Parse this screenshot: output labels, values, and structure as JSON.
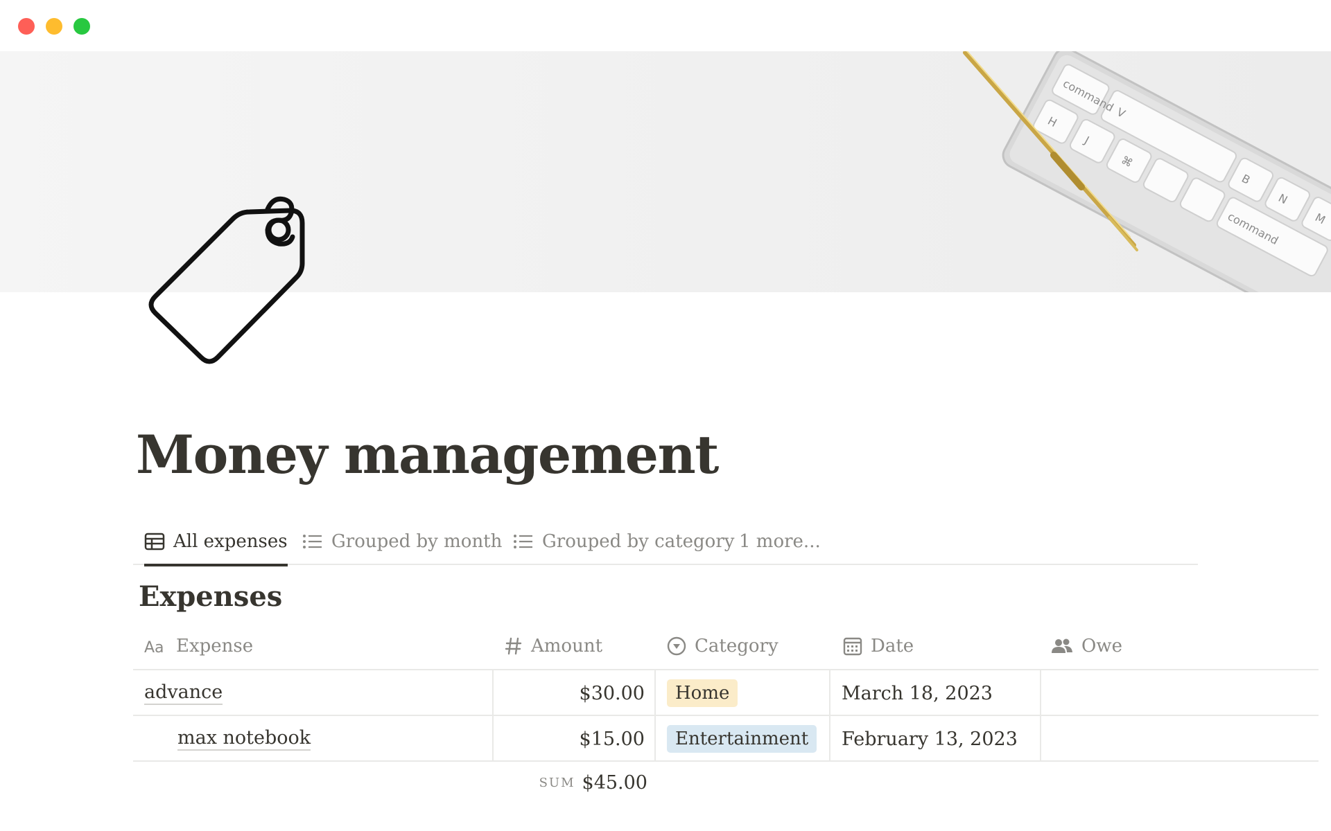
{
  "window": {
    "controls": [
      "close",
      "minimize",
      "maximize"
    ],
    "colors": {
      "close": "#fe5f57",
      "minimize": "#febc2e",
      "maximize": "#28c840"
    }
  },
  "cover": {
    "description_icon": "desk-cover-image",
    "keyboard_keys": [
      "command",
      "V",
      "B",
      "N",
      "M",
      "H",
      "J",
      "⌘",
      "command"
    ]
  },
  "page": {
    "icon": "price-tag-icon",
    "title": "Money management"
  },
  "views": {
    "tabs": [
      {
        "label": "All expenses",
        "icon": "table-icon",
        "active": true
      },
      {
        "label": "Grouped by month",
        "icon": "list-icon",
        "active": false
      },
      {
        "label": "Grouped by category",
        "icon": "list-icon",
        "active": false
      },
      {
        "label": "1 more...",
        "icon": "",
        "active": false
      }
    ]
  },
  "database": {
    "title": "Expenses",
    "columns": [
      {
        "label": "Expense",
        "icon": "text-property-icon"
      },
      {
        "label": "Amount",
        "icon": "number-property-icon"
      },
      {
        "label": "Category",
        "icon": "select-property-icon"
      },
      {
        "label": "Date",
        "icon": "calendar-icon"
      },
      {
        "label": "Owe",
        "icon": "people-icon"
      }
    ],
    "rows": [
      {
        "expense": "advance",
        "amount": "$30.00",
        "category": "Home",
        "category_color": "#fbecc9",
        "date": "March 18, 2023",
        "owe": ""
      },
      {
        "expense": "max notebook",
        "amount": "$15.00",
        "category": "Entertainment",
        "category_color": "#d9e8f2",
        "date": "February 13, 2023",
        "owe": ""
      }
    ],
    "summary": {
      "label": "SUM",
      "value": "$45.00"
    }
  }
}
